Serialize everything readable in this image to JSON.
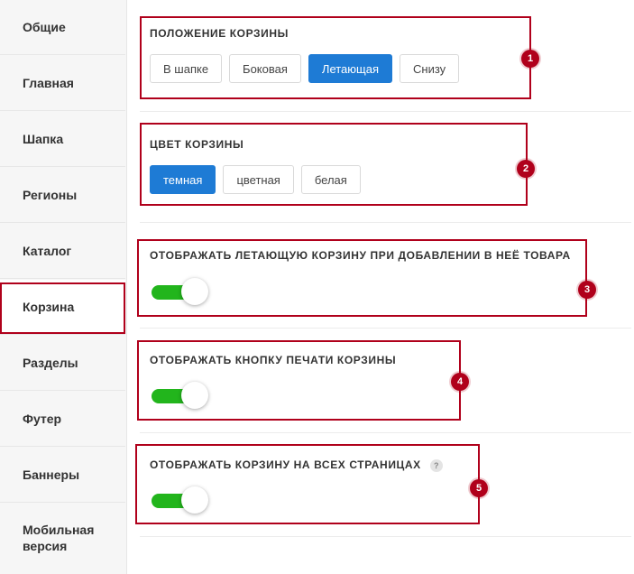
{
  "sidebar": {
    "items": [
      {
        "label": "Общие"
      },
      {
        "label": "Главная"
      },
      {
        "label": "Шапка"
      },
      {
        "label": "Регионы"
      },
      {
        "label": "Каталог"
      },
      {
        "label": "Корзина"
      },
      {
        "label": "Разделы"
      },
      {
        "label": "Футер"
      },
      {
        "label": "Баннеры"
      },
      {
        "label": "Мобильная"
      }
    ],
    "mobile_line2": "версия",
    "active": "Корзина"
  },
  "basket_position": {
    "title": "ПОЛОЖЕНИЕ КОРЗИНЫ",
    "options": [
      "В шапке",
      "Боковая",
      "Летающая",
      "Снизу"
    ],
    "selected": "Летающая"
  },
  "basket_color": {
    "title": "ЦВЕТ КОРЗИНЫ",
    "options": [
      "темная",
      "цветная",
      "белая"
    ],
    "selected": "темная"
  },
  "show_flying": {
    "title": "ОТОБРАЖАТЬ ЛЕТАЮЩУЮ КОРЗИНУ ПРИ ДОБАВЛЕНИИ В НЕЁ ТОВАРА",
    "on": true
  },
  "show_print": {
    "title": "ОТОБРАЖАТЬ КНОПКУ ПЕЧАТИ КОРЗИНЫ",
    "on": true
  },
  "show_all_pages": {
    "title": "ОТОБРАЖАТЬ КОРЗИНУ НА ВСЕХ СТРАНИЦАХ",
    "help": "?",
    "on": true
  },
  "markers": [
    "1",
    "2",
    "3",
    "4",
    "5"
  ],
  "colors": {
    "accent": "#1e7bd5",
    "toggle_on": "#22b51c",
    "highlight": "#b0001b"
  }
}
